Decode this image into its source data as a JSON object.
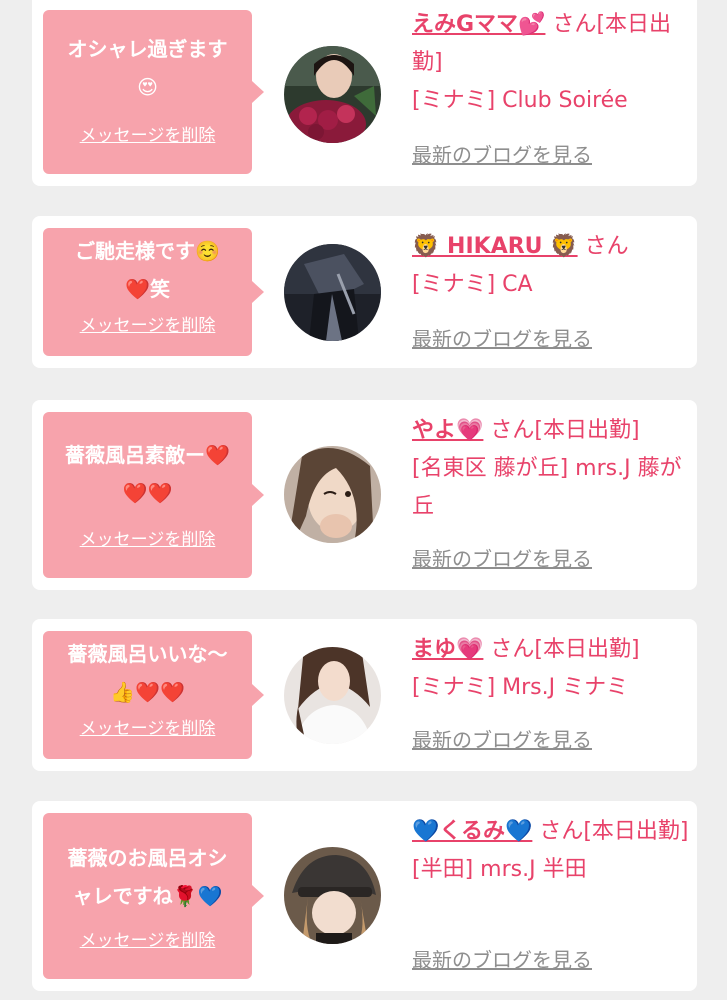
{
  "colors": {
    "bubble": "#f7a3ac",
    "accent": "#e8426a",
    "link_gray": "#8e8e8e",
    "page_bg": "#eeeeee"
  },
  "cards": [
    {
      "message": "オシャレ過ぎます\n😍",
      "delete_label": "メッセージを削除",
      "name": "えみGママ💕",
      "san_text": " さん[本日出勤]",
      "shop": "[ミナミ] Club Soirée",
      "blog_label": "最新のブログを見る",
      "avatar_icon": "woman-with-roses-photo"
    },
    {
      "message": "ご馳走様です☺️\n❤️笑",
      "delete_label": "メッセージを削除",
      "name": "🦁 HIKARU 🦁",
      "san_text": " さん",
      "shop": "[ミナミ] CA",
      "blog_label": "最新のブログを見る",
      "avatar_icon": "dark-portrait-photo"
    },
    {
      "message": "薔薇風呂素敵ー❤️\n❤️❤️",
      "delete_label": "メッセージを削除",
      "name": "やよ💗",
      "san_text": " さん[本日出勤]",
      "shop": "[名東区 藤が丘] mrs.J 藤が丘",
      "blog_label": "最新のブログを見る",
      "avatar_icon": "woman-winking-photo"
    },
    {
      "message": "薔薇風呂いいな〜\n👍❤️❤️",
      "delete_label": "メッセージを削除",
      "name": "まゆ💗",
      "san_text": " さん[本日出勤]",
      "shop": "[ミナミ] Mrs.J ミナミ",
      "blog_label": "最新のブログを見る",
      "avatar_icon": "woman-white-top-photo"
    },
    {
      "message": "薔薇のお風呂オシ\nャレですね🌹💙",
      "delete_label": "メッセージを削除",
      "name": "💙くるみ💙",
      "san_text": " さん[本日出勤]",
      "shop": "[半田] mrs.J 半田",
      "blog_label": "最新のブログを見る",
      "avatar_icon": "woman-with-cap-photo"
    }
  ]
}
